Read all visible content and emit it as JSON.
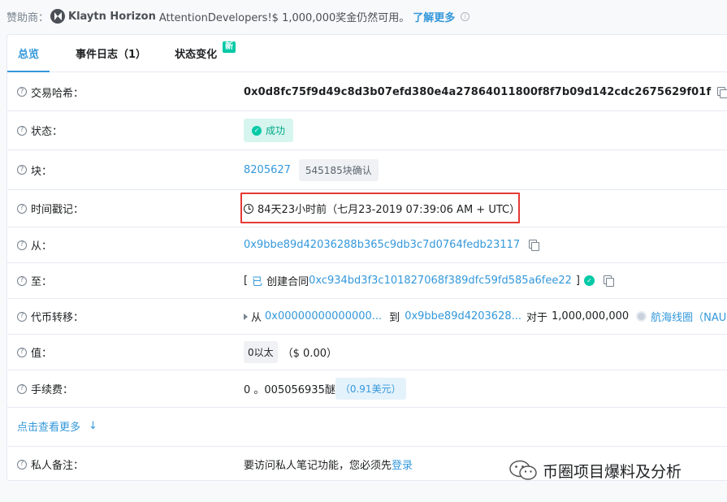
{
  "sponsor": {
    "label": "赞助商：",
    "brand": "Klaytn Horizon",
    "message": "AttentionDevelopers!$ 1,000,000奖金仍然可用。",
    "more": "了解更多",
    "info_icon": "i"
  },
  "tabs": [
    {
      "label": "总览",
      "active": true
    },
    {
      "label": "事件日志（1）",
      "active": false
    },
    {
      "label": "状态变化",
      "active": false,
      "badge": "新"
    }
  ],
  "rows": {
    "tx_hash": {
      "label": "交易哈希：",
      "value": "0x0d8fc75f9d49c8d3b07efd380e4a27864011800f8f7b09d142cdc2675629f01f"
    },
    "status": {
      "label": "状态：",
      "value": "成功"
    },
    "block": {
      "label": "块：",
      "value": "8205627",
      "confirmations": "545185块确认"
    },
    "timestamp": {
      "label": "时间戳记：",
      "value": "84天23小时前（七月23-2019 07:39:06 AM + UTC）"
    },
    "from": {
      "label": "从：",
      "value": "0x9bbe89d42036288b365c9db3c7d0764fedb23117"
    },
    "to": {
      "label": "至：",
      "bracket_open": "[",
      "prefix": "已",
      "created": "创建合同",
      "address": "0xc934bd3f3c101827068f389dfc59fd585a6fee22",
      "bracket_close": "]"
    },
    "token_transfer": {
      "label": "代币转移：",
      "from_label": "从",
      "from_addr": "0x00000000000000...",
      "to_label": "到",
      "to_addr": "0x9bbe89d4203628...",
      "for_label": "对于",
      "amount": "1,000,000,000",
      "token": "航海线圈（NAUC）"
    },
    "value": {
      "label": "值：",
      "badge": "0以太",
      "usd": "（$ 0.00）"
    },
    "fee": {
      "label": "手续费：",
      "value": "0 。005056935醚",
      "usd": "（0.91美元）"
    },
    "note": {
      "label": "私人备注：",
      "text": "要访问私人笔记功能，您必须先",
      "login": "登录"
    }
  },
  "show_more": "点击查看更多",
  "watermark": "币圈项目爆料及分析",
  "colors": {
    "accent": "#3498db",
    "success": "#00c9a7",
    "highlight_box": "#e53935"
  }
}
